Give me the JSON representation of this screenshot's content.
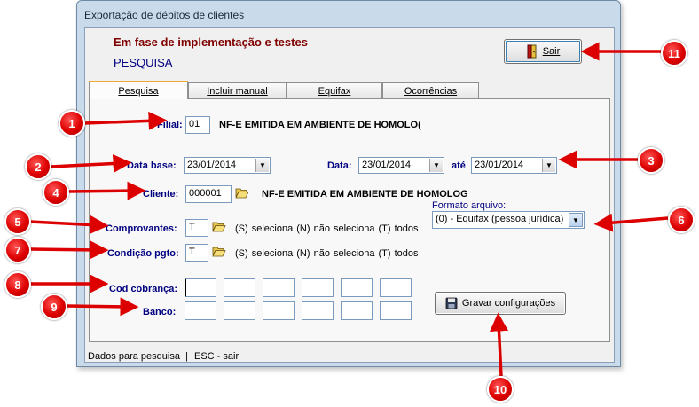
{
  "window": {
    "title": "Exportação de débitos de clientes"
  },
  "header": {
    "status_line": "Em fase de implementação e testes",
    "mode": "PESQUISA"
  },
  "toolbar": {
    "exit_label": "Sair"
  },
  "tabs": [
    {
      "label": "Pesquisa",
      "active": true
    },
    {
      "label": "Incluir manual",
      "active": false
    },
    {
      "label": "Equifax",
      "active": false
    },
    {
      "label": "Ocorrências",
      "active": false
    }
  ],
  "form": {
    "filial": {
      "label": "Filial:",
      "value": "01",
      "description": "NF-E EMITIDA EM AMBIENTE DE HOMOLO("
    },
    "data_base": {
      "label": "Data base:",
      "value": "23/01/2014"
    },
    "data": {
      "label": "Data:",
      "from": "23/01/2014",
      "until_label": "até",
      "to": "23/01/2014"
    },
    "cliente": {
      "label": "Cliente:",
      "value": "000001",
      "description": "NF-E EMITIDA EM AMBIENTE DE HOMOLOG"
    },
    "comprovantes": {
      "label": "Comprovantes:",
      "value": "T",
      "hint": "(S) seleciona  (N) não seleciona  (T) todos"
    },
    "condicao_pgto": {
      "label": "Condição pgto:",
      "value": "T",
      "hint": "(S) seleciona  (N) não seleciona  (T) todos"
    },
    "formato_arquivo": {
      "label": "Formato arquivo:",
      "value": "(0) - Equifax (pessoa jurídica)"
    },
    "cod_cobranca": {
      "label": "Cod cobrança:",
      "values": [
        "",
        "",
        "",
        "",
        "",
        ""
      ]
    },
    "banco": {
      "label": "Banco:",
      "values": [
        "",
        "",
        "",
        "",
        "",
        ""
      ]
    },
    "save_label": "Gravar configurações"
  },
  "statusbar": {
    "left": "Dados para pesquisa",
    "separator": "|",
    "right": "ESC - sair"
  },
  "callouts": [
    "1",
    "2",
    "3",
    "4",
    "5",
    "6",
    "7",
    "8",
    "9",
    "10",
    "11"
  ],
  "colors": {
    "callout_red": "#dd0000",
    "label_blue": "#000080",
    "header_red": "#800000",
    "tab_accent": "#f0a830"
  }
}
